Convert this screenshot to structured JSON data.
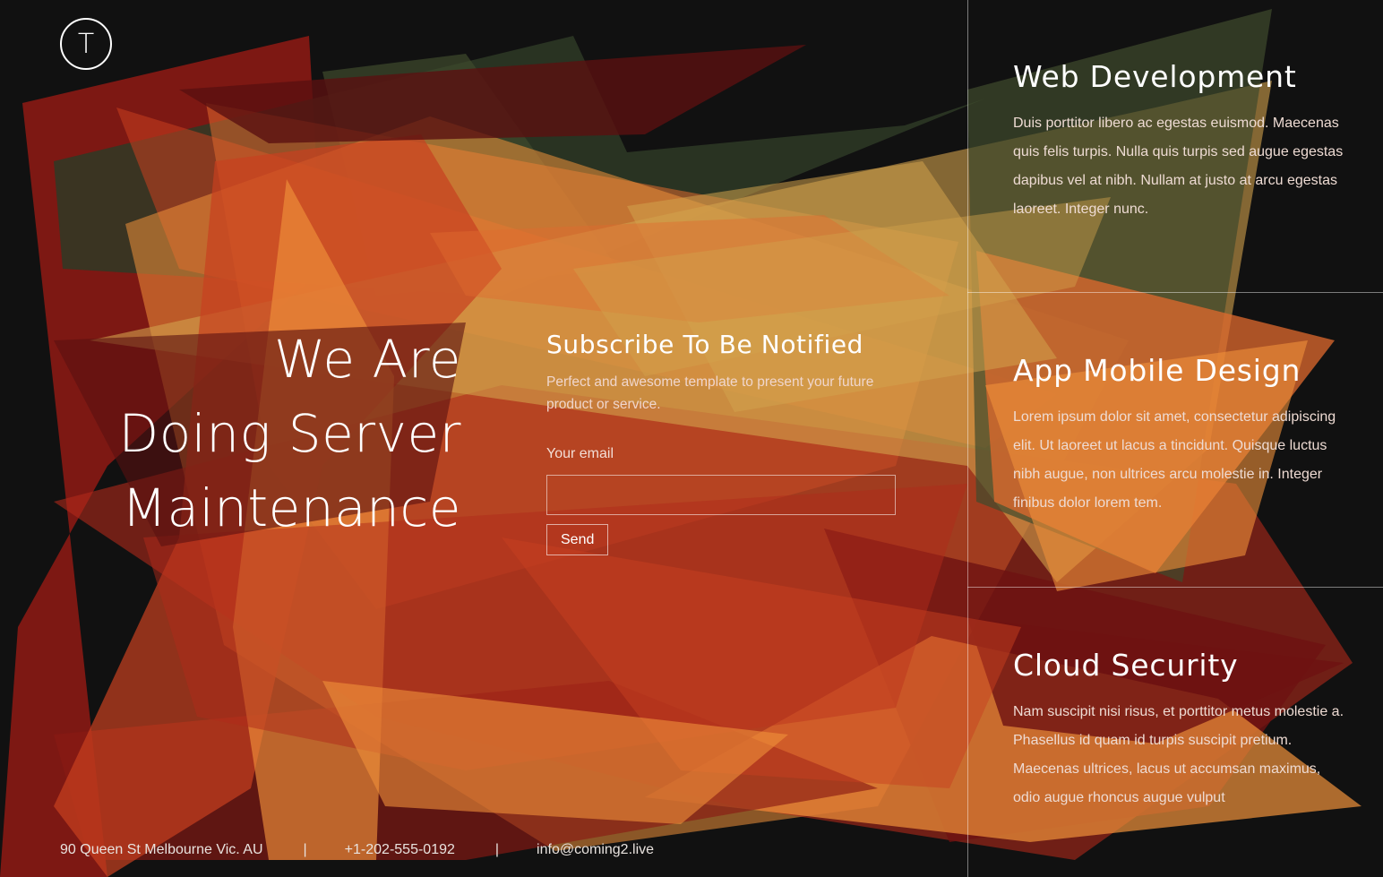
{
  "logo": {
    "letter": "T"
  },
  "hero": {
    "lines": [
      "We Are",
      "Doing Server",
      "Maintenance"
    ]
  },
  "subscribe": {
    "title": "Subscribe To Be Notified",
    "description": "Perfect and awesome template to present your future product or service.",
    "email_label": "Your email",
    "email_value": "",
    "send_label": "Send"
  },
  "services": [
    {
      "title": "Web Development",
      "text": "Duis porttitor libero ac egestas euismod. Maecenas quis felis turpis. Nulla quis turpis sed augue egestas dapibus vel at nibh. Nullam at justo at arcu egestas laoreet. Integer nunc."
    },
    {
      "title": "App Mobile Design",
      "text": "Lorem ipsum dolor sit amet, consectetur adipiscing elit. Ut laoreet ut lacus a tincidunt. Quisque luctus nibh augue, non ultrices arcu molestie in. Integer finibus dolor lorem tem."
    },
    {
      "title": "Cloud Security",
      "text": "Nam suscipit nisi risus, et porttitor metus molestie a. Phasellus id quam id turpis suscipit pretium. Maecenas ultrices, lacus ut accumsan maximus, odio augue rhoncus augue vulput"
    }
  ],
  "footer": {
    "address": "90 Queen St Melbourne Vic. AU",
    "separator": "|",
    "phone": "+1-202-555-0192",
    "email": "info@coming2.live"
  },
  "colors": {
    "background": "#111111",
    "palette": [
      "#6e1212",
      "#8a1a14",
      "#b02a1a",
      "#c8401f",
      "#e06a2e",
      "#f0913a",
      "#d2a24c",
      "#2e3a26",
      "#3f4a2c",
      "#5a1010"
    ]
  }
}
